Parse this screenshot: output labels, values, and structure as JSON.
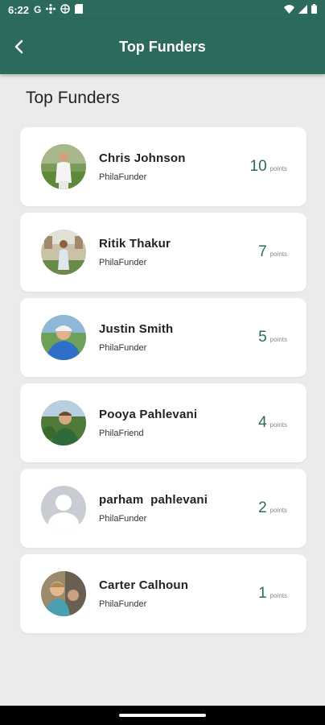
{
  "status_bar": {
    "time": "6:22",
    "left_icons": [
      "google-icon",
      "share-icon",
      "vpn-icon",
      "storage-icon"
    ],
    "right_icons": [
      "wifi-icon",
      "cellular-signal-icon",
      "battery-icon"
    ]
  },
  "app_bar": {
    "title": "Top Funders",
    "back_icon": "arrow-back-icon",
    "background_color": "#2c6a5e"
  },
  "page": {
    "heading": "Top Funders"
  },
  "funders": [
    {
      "name": "Chris Johnson",
      "role": "PhilaFunder",
      "points": "10",
      "points_label": "points",
      "avatar": "photo"
    },
    {
      "name": "Ritik Thakur",
      "role": "PhilaFunder",
      "points": "7",
      "points_label": "points",
      "avatar": "photo"
    },
    {
      "name": "Justin Smith",
      "role": "PhilaFunder",
      "points": "5",
      "points_label": "points",
      "avatar": "photo"
    },
    {
      "name": "Pooya Pahlevani",
      "role": "PhilaFriend",
      "points": "4",
      "points_label": "points",
      "avatar": "photo"
    },
    {
      "name": "parham  pahlevani",
      "role": "PhilaFunder",
      "points": "2",
      "points_label": "points",
      "avatar": "default-user-icon"
    },
    {
      "name": "Carter Calhoun",
      "role": "PhilaFunder",
      "points": "1",
      "points_label": "points",
      "avatar": "photo"
    }
  ],
  "colors": {
    "accent": "#2c6a5e",
    "background": "#ebebeb",
    "card": "#ffffff"
  }
}
